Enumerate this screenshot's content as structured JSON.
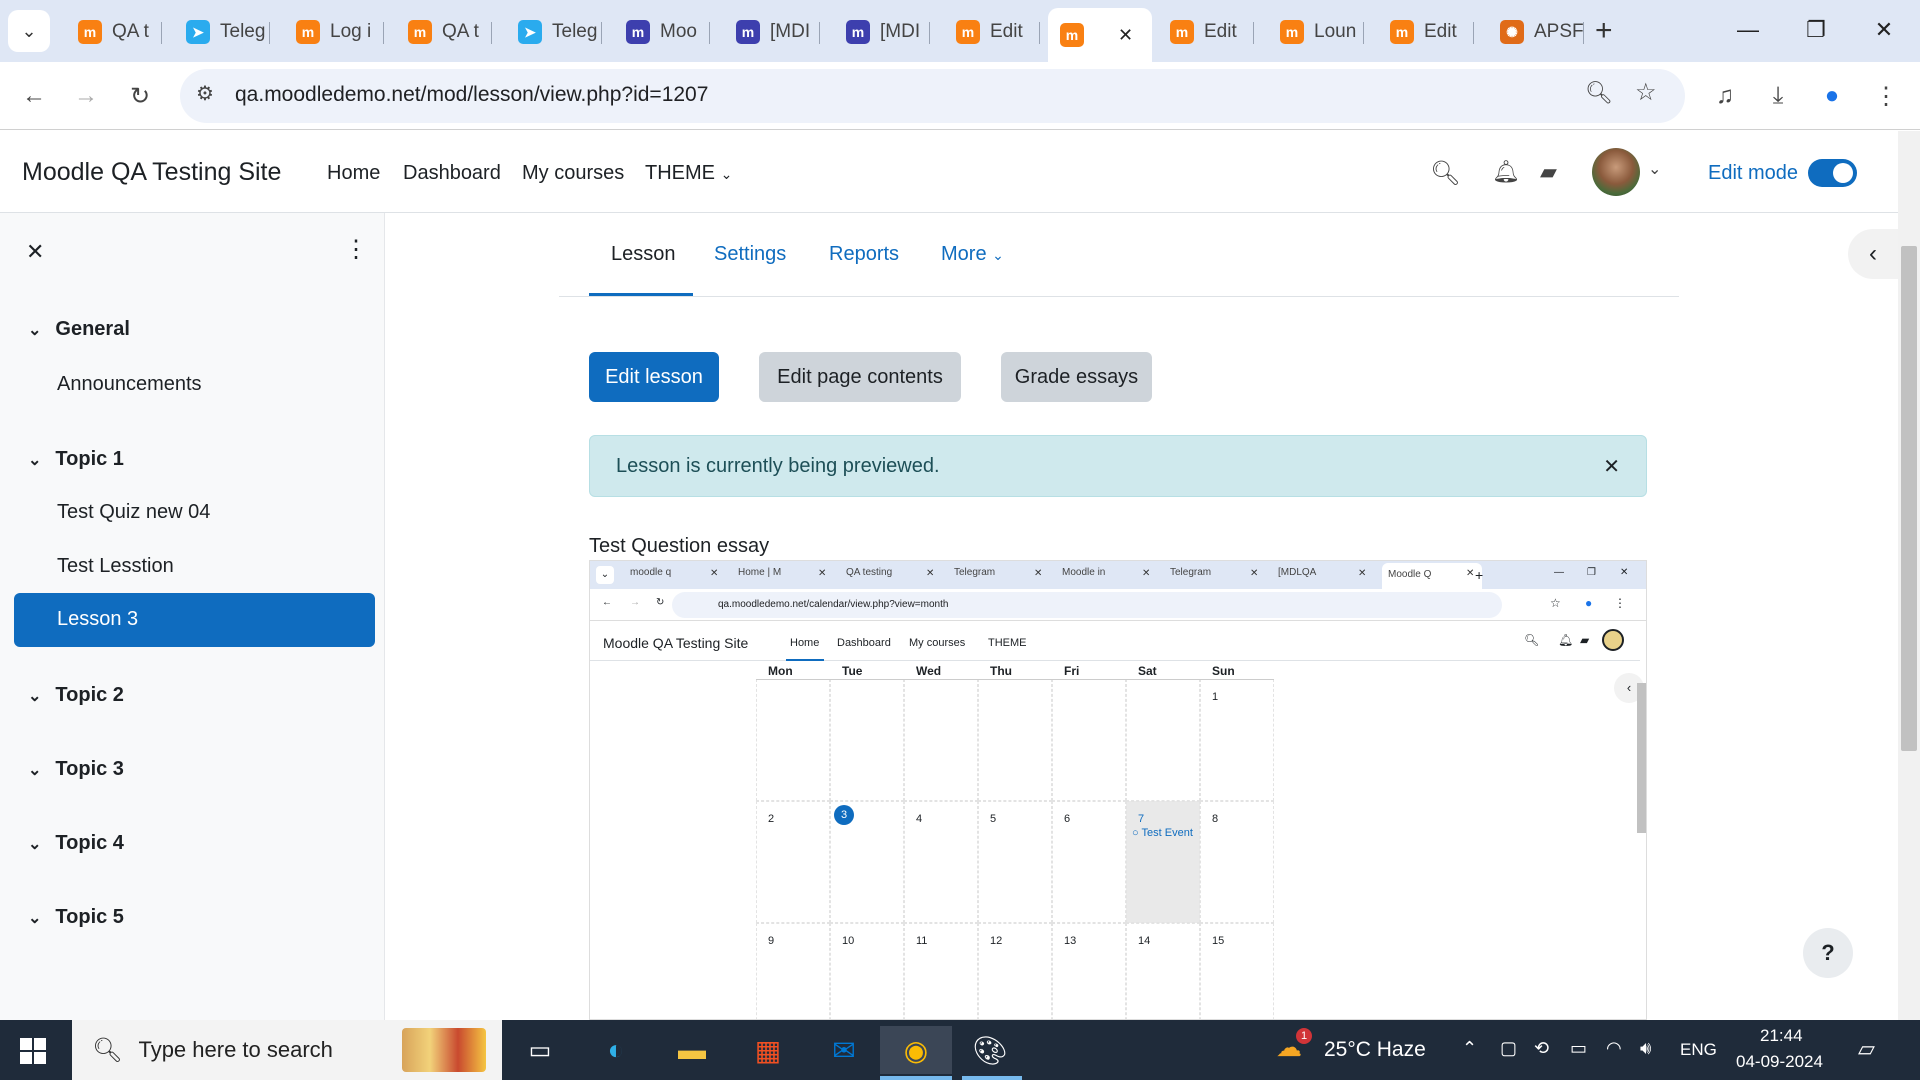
{
  "browser": {
    "tabs": [
      {
        "label": "QA t",
        "icon": "moodle-icon",
        "color": "#f98012"
      },
      {
        "label": "Teleg",
        "icon": "telegram-icon",
        "color": "#2aabee"
      },
      {
        "label": "Log i",
        "icon": "moodle-icon",
        "color": "#f98012"
      },
      {
        "label": "QA t",
        "icon": "moodle-icon",
        "color": "#f98012"
      },
      {
        "label": "Teleg",
        "icon": "telegram-icon",
        "color": "#2aabee"
      },
      {
        "label": "Moo",
        "icon": "moodle-tracker-icon",
        "color": "#3d3fae"
      },
      {
        "label": "[MDI",
        "icon": "moodle-tracker-icon",
        "color": "#3d3fae"
      },
      {
        "label": "[MDI",
        "icon": "moodle-tracker-icon",
        "color": "#3d3fae"
      },
      {
        "label": "Edit",
        "icon": "moodle-hat-icon",
        "color": "#f98012"
      },
      {
        "label": "",
        "icon": "moodle-hat-icon",
        "color": "#f98012"
      },
      {
        "label": "Edit",
        "icon": "moodle-hat-icon",
        "color": "#f98012"
      },
      {
        "label": "Loun",
        "icon": "moodle-hat-icon",
        "color": "#f98012"
      },
      {
        "label": "Edit",
        "icon": "moodle-hat-icon",
        "color": "#f98012"
      },
      {
        "label": "APSF",
        "icon": "apsf-icon",
        "color": "#e06b18"
      }
    ],
    "url": "qa.moodledemo.net/mod/lesson/view.php?id=1207"
  },
  "moodle": {
    "site_name": "Moodle QA Testing Site",
    "nav": [
      "Home",
      "Dashboard",
      "My courses",
      "THEME"
    ],
    "edit_mode_label": "Edit mode",
    "edit_mode_on": true,
    "sections": [
      {
        "title": "General",
        "items": [
          "Announcements"
        ]
      },
      {
        "title": "Topic 1",
        "items": [
          "Test Quiz new 04",
          "Test Lesstion",
          "Lesson 3"
        ]
      },
      {
        "title": "Topic 2",
        "items": []
      },
      {
        "title": "Topic 3",
        "items": []
      },
      {
        "title": "Topic 4",
        "items": []
      },
      {
        "title": "Topic 5",
        "items": []
      }
    ],
    "active_item": "Lesson 3",
    "tabs": [
      "Lesson",
      "Settings",
      "Reports",
      "More"
    ],
    "active_tab": "Lesson",
    "buttons": [
      "Edit lesson",
      "Edit page contents",
      "Grade essays"
    ],
    "alert": "Lesson is currently being previewed.",
    "question_title": "Test Question essay",
    "help_label": "?"
  },
  "embedded": {
    "tabs": [
      "moodle q",
      "Home | M",
      "QA testing",
      "Telegram",
      "Moodle in",
      "Telegram",
      "[MDLQA",
      "Moodle Q"
    ],
    "url": "qa.moodledemo.net/calendar/view.php?view=month",
    "site_name": "Moodle QA Testing Site",
    "nav": [
      "Home",
      "Dashboard",
      "My courses",
      "THEME"
    ],
    "days": [
      "Mon",
      "Tue",
      "Wed",
      "Thu",
      "Fri",
      "Sat",
      "Sun"
    ],
    "week1": [
      "",
      "",
      "",
      "",
      "",
      "",
      "1"
    ],
    "week2": [
      "2",
      "3",
      "4",
      "5",
      "6",
      "7",
      "8"
    ],
    "week3": [
      "9",
      "10",
      "11",
      "12",
      "13",
      "14",
      "15"
    ],
    "event": "Test Event",
    "today": "3"
  },
  "taskbar": {
    "search_placeholder": "Type here to search",
    "weather": "25°C  Haze",
    "weather_badge": "1",
    "lang": "ENG",
    "time": "21:44",
    "date": "04-09-2024"
  }
}
